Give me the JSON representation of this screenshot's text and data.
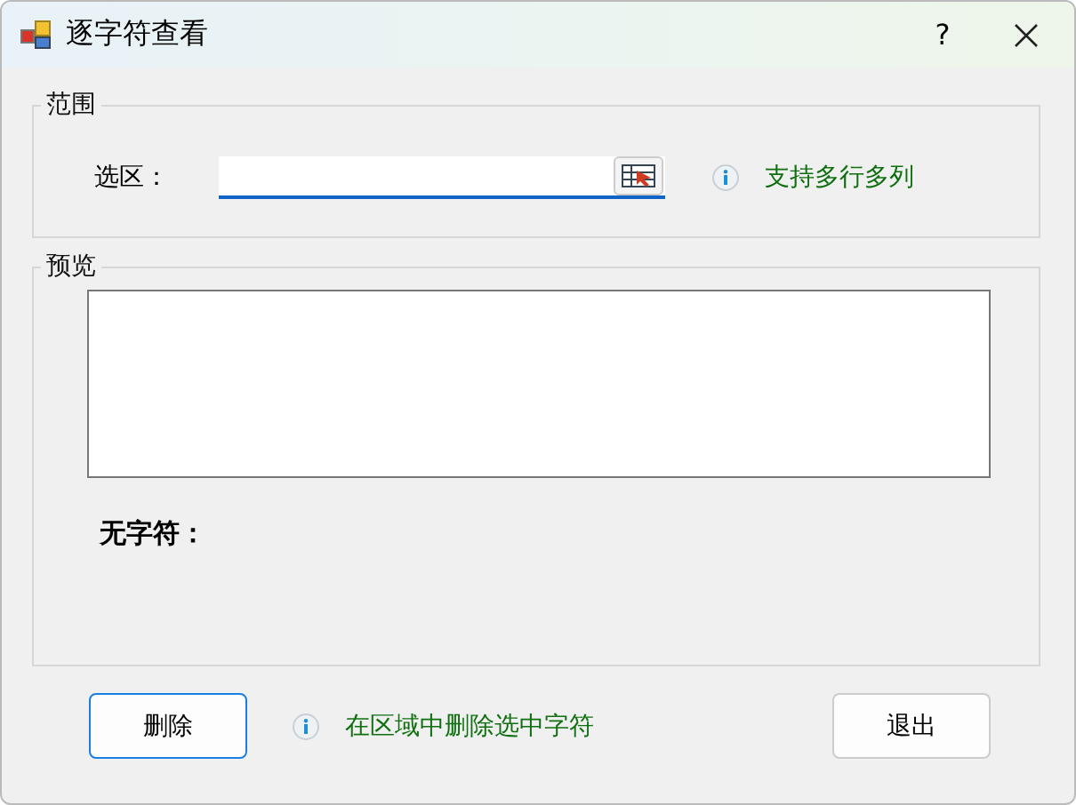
{
  "window": {
    "title": "逐字符查看",
    "help": "?"
  },
  "range_group": {
    "title": "范围",
    "label": "选区：",
    "hint": "支持多行多列"
  },
  "preview_group": {
    "title": "预览",
    "status": "无字符："
  },
  "footer": {
    "buttons": [
      {
        "label": "删除",
        "focused": true
      },
      {
        "label": "退出",
        "focused": false
      }
    ],
    "hint": "在区域中删除选中字符"
  }
}
